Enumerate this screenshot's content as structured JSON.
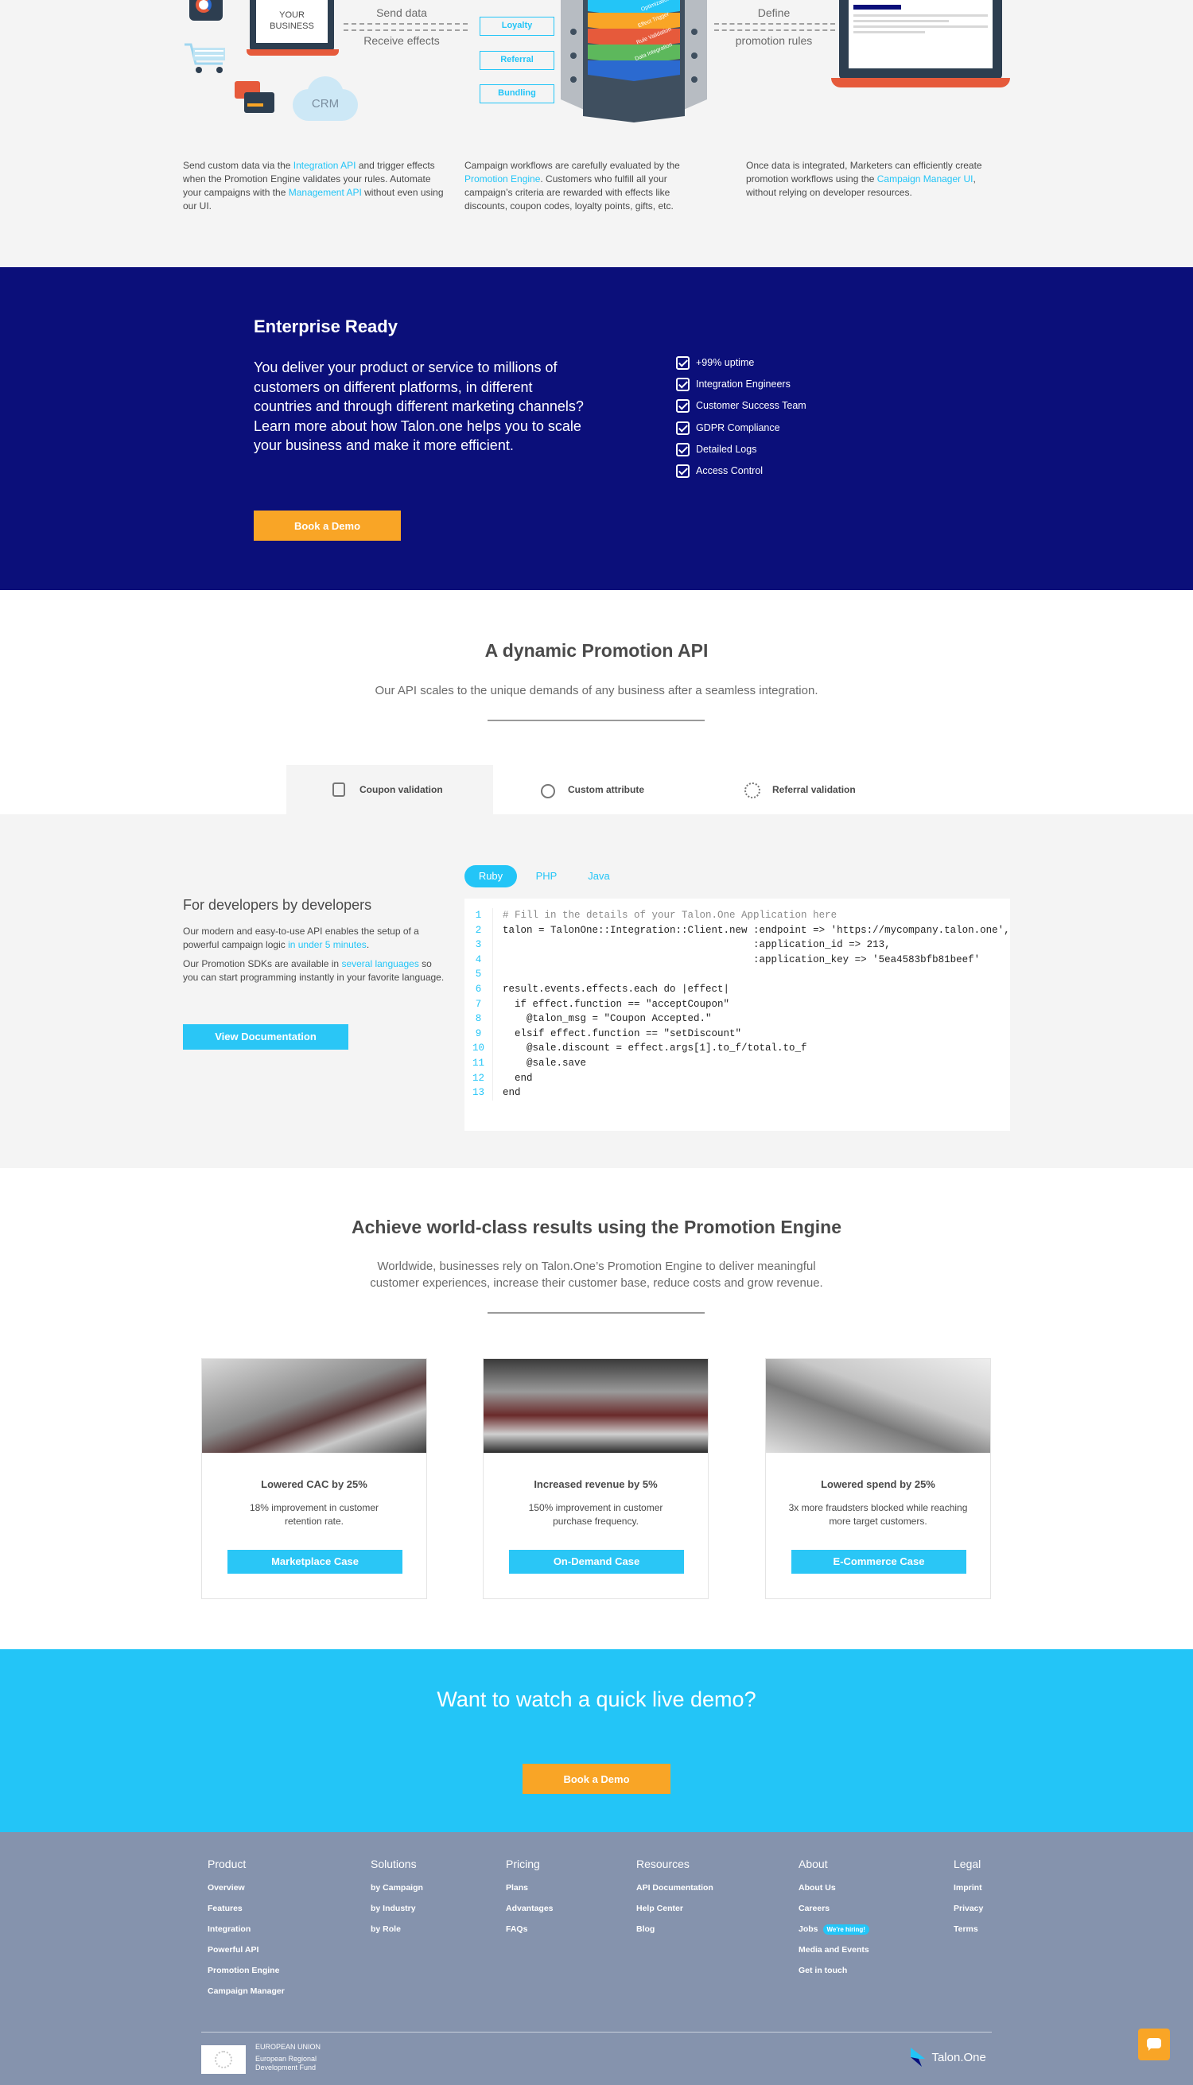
{
  "integration": {
    "business_label": "YOUR BUSINESS",
    "send_data": "Send data",
    "receive_effects": "Receive effects",
    "crm_label": "CRM",
    "define": "Define",
    "promotion_rules": "promotion rules",
    "campaign_types": [
      "Loyalty",
      "Referral",
      "Bundling"
    ],
    "stack_layers": [
      "Optimization",
      "Effect Trigger",
      "Rule Validation",
      "Data Integration"
    ],
    "col1": {
      "t1": "Send custom data via the ",
      "l1": "Integration API",
      "t2": " and trigger effects when the Promotion Engine validates your rules. Automate your campaigns with the ",
      "l2": "Management API",
      "t3": " without even using our UI."
    },
    "col2": {
      "t1": "Campaign workflows are carefully evaluated by the ",
      "l1": "Promotion Engine",
      "t2": ". Customers who fulfill all your campaign’s criteria are rewarded with effects like discounts, coupon codes, loyalty points, gifts, etc."
    },
    "col3": {
      "t1": "Once data is integrated, Marketers can efficiently create promotion workflows using the ",
      "l1": "Campaign Manager UI",
      "t2": ", without relying on developer resources."
    }
  },
  "enterprise": {
    "title": "Enterprise Ready",
    "body": "You deliver your product or service to millions of customers on different platforms, in different countries and through different marketing channels? Learn more about how Talon.one helps you to scale your business and make it more efficient.",
    "cta": "Book a Demo",
    "features": [
      "+99% uptime",
      "Integration Engineers",
      "Customer Success Team",
      "GDPR Compliance",
      "Detailed Logs",
      "Access Control"
    ]
  },
  "api": {
    "title": "A dynamic Promotion API",
    "subtitle": "Our API scales to the unique demands of any business after a seamless integration.",
    "tabs": [
      "Coupon validation",
      "Custom attribute",
      "Referral validation"
    ],
    "dev_title": "For developers by developers",
    "dev_p1a": "Our modern and easy-to-use API enables the setup of a powerful campaign logic ",
    "dev_p1link": "in under 5 minutes",
    "dev_p1b": ".",
    "dev_p2a": "Our Promotion SDKs are available in ",
    "dev_p2link": "several languages",
    "dev_p2b": " so you can start programming instantly in your favorite language.",
    "docs_button": "View Documentation",
    "langs": [
      "Ruby",
      "PHP",
      "Java"
    ],
    "code_lines": [
      "# Fill in the details of your Talon.One Application here",
      "talon = TalonOne::Integration::Client.new :endpoint => 'https://mycompany.talon.one',",
      "                                          :application_id => 213,",
      "                                          :application_key => '5ea4583bfb81beef'",
      "",
      "result.events.effects.each do |effect|",
      "  if effect.function == \"acceptCoupon\"",
      "    @talon_msg = \"Coupon Accepted.\"",
      "  elsif effect.function == \"setDiscount\"",
      "    @sale.discount = effect.args[1].to_f/total.to_f",
      "    @sale.save",
      "  end",
      "end"
    ]
  },
  "results": {
    "title": "Achieve world-class results using the Promotion Engine",
    "subtitle1": "Worldwide, businesses rely on Talon.One’s Promotion Engine to deliver meaningful",
    "subtitle2": "customer experiences, increase their customer base, reduce costs and grow revenue.",
    "cards": [
      {
        "title": "Lowered CAC by 25%",
        "text": "18% improvement in customer retention rate.",
        "button": "Marketplace Case"
      },
      {
        "title": "Increased revenue by 5%",
        "text": "150% improvement in customer purchase frequency.",
        "button": "On-Demand Case"
      },
      {
        "title": "Lowered spend by 25%",
        "text": "3x more fraudsters blocked while reaching more target customers.",
        "button": "E-Commerce Case"
      }
    ]
  },
  "demo": {
    "title": "Want to watch a quick live demo?",
    "cta": "Book a Demo"
  },
  "footer": {
    "cols": [
      {
        "h": "Product",
        "items": [
          "Overview",
          "Features",
          "Integration",
          "Powerful API",
          "Promotion Engine",
          "Campaign Manager"
        ]
      },
      {
        "h": "Solutions",
        "items": [
          "by Campaign",
          "by Industry",
          "by Role"
        ]
      },
      {
        "h": "Pricing",
        "items": [
          "Plans",
          "Advantages",
          "FAQs"
        ]
      },
      {
        "h": "Resources",
        "items": [
          "API Documentation",
          "Help Center",
          "Blog"
        ]
      },
      {
        "h": "About",
        "items": [
          "About Us",
          "Careers",
          "Jobs",
          "Media and Events",
          "Get in touch"
        ]
      },
      {
        "h": "Legal",
        "items": [
          "Imprint",
          "Privacy",
          "Terms"
        ]
      }
    ],
    "hiring_badge": "We're hiring!",
    "eu1": "EUROPEAN UNION",
    "eu2": "European Regional",
    "eu3": "Development Fund",
    "brand": "Talon.One"
  },
  "colors": {
    "navy": "#0b0f7a",
    "cyan": "#23c5f7",
    "orange": "#f9a526",
    "footer": "#8593ad"
  }
}
